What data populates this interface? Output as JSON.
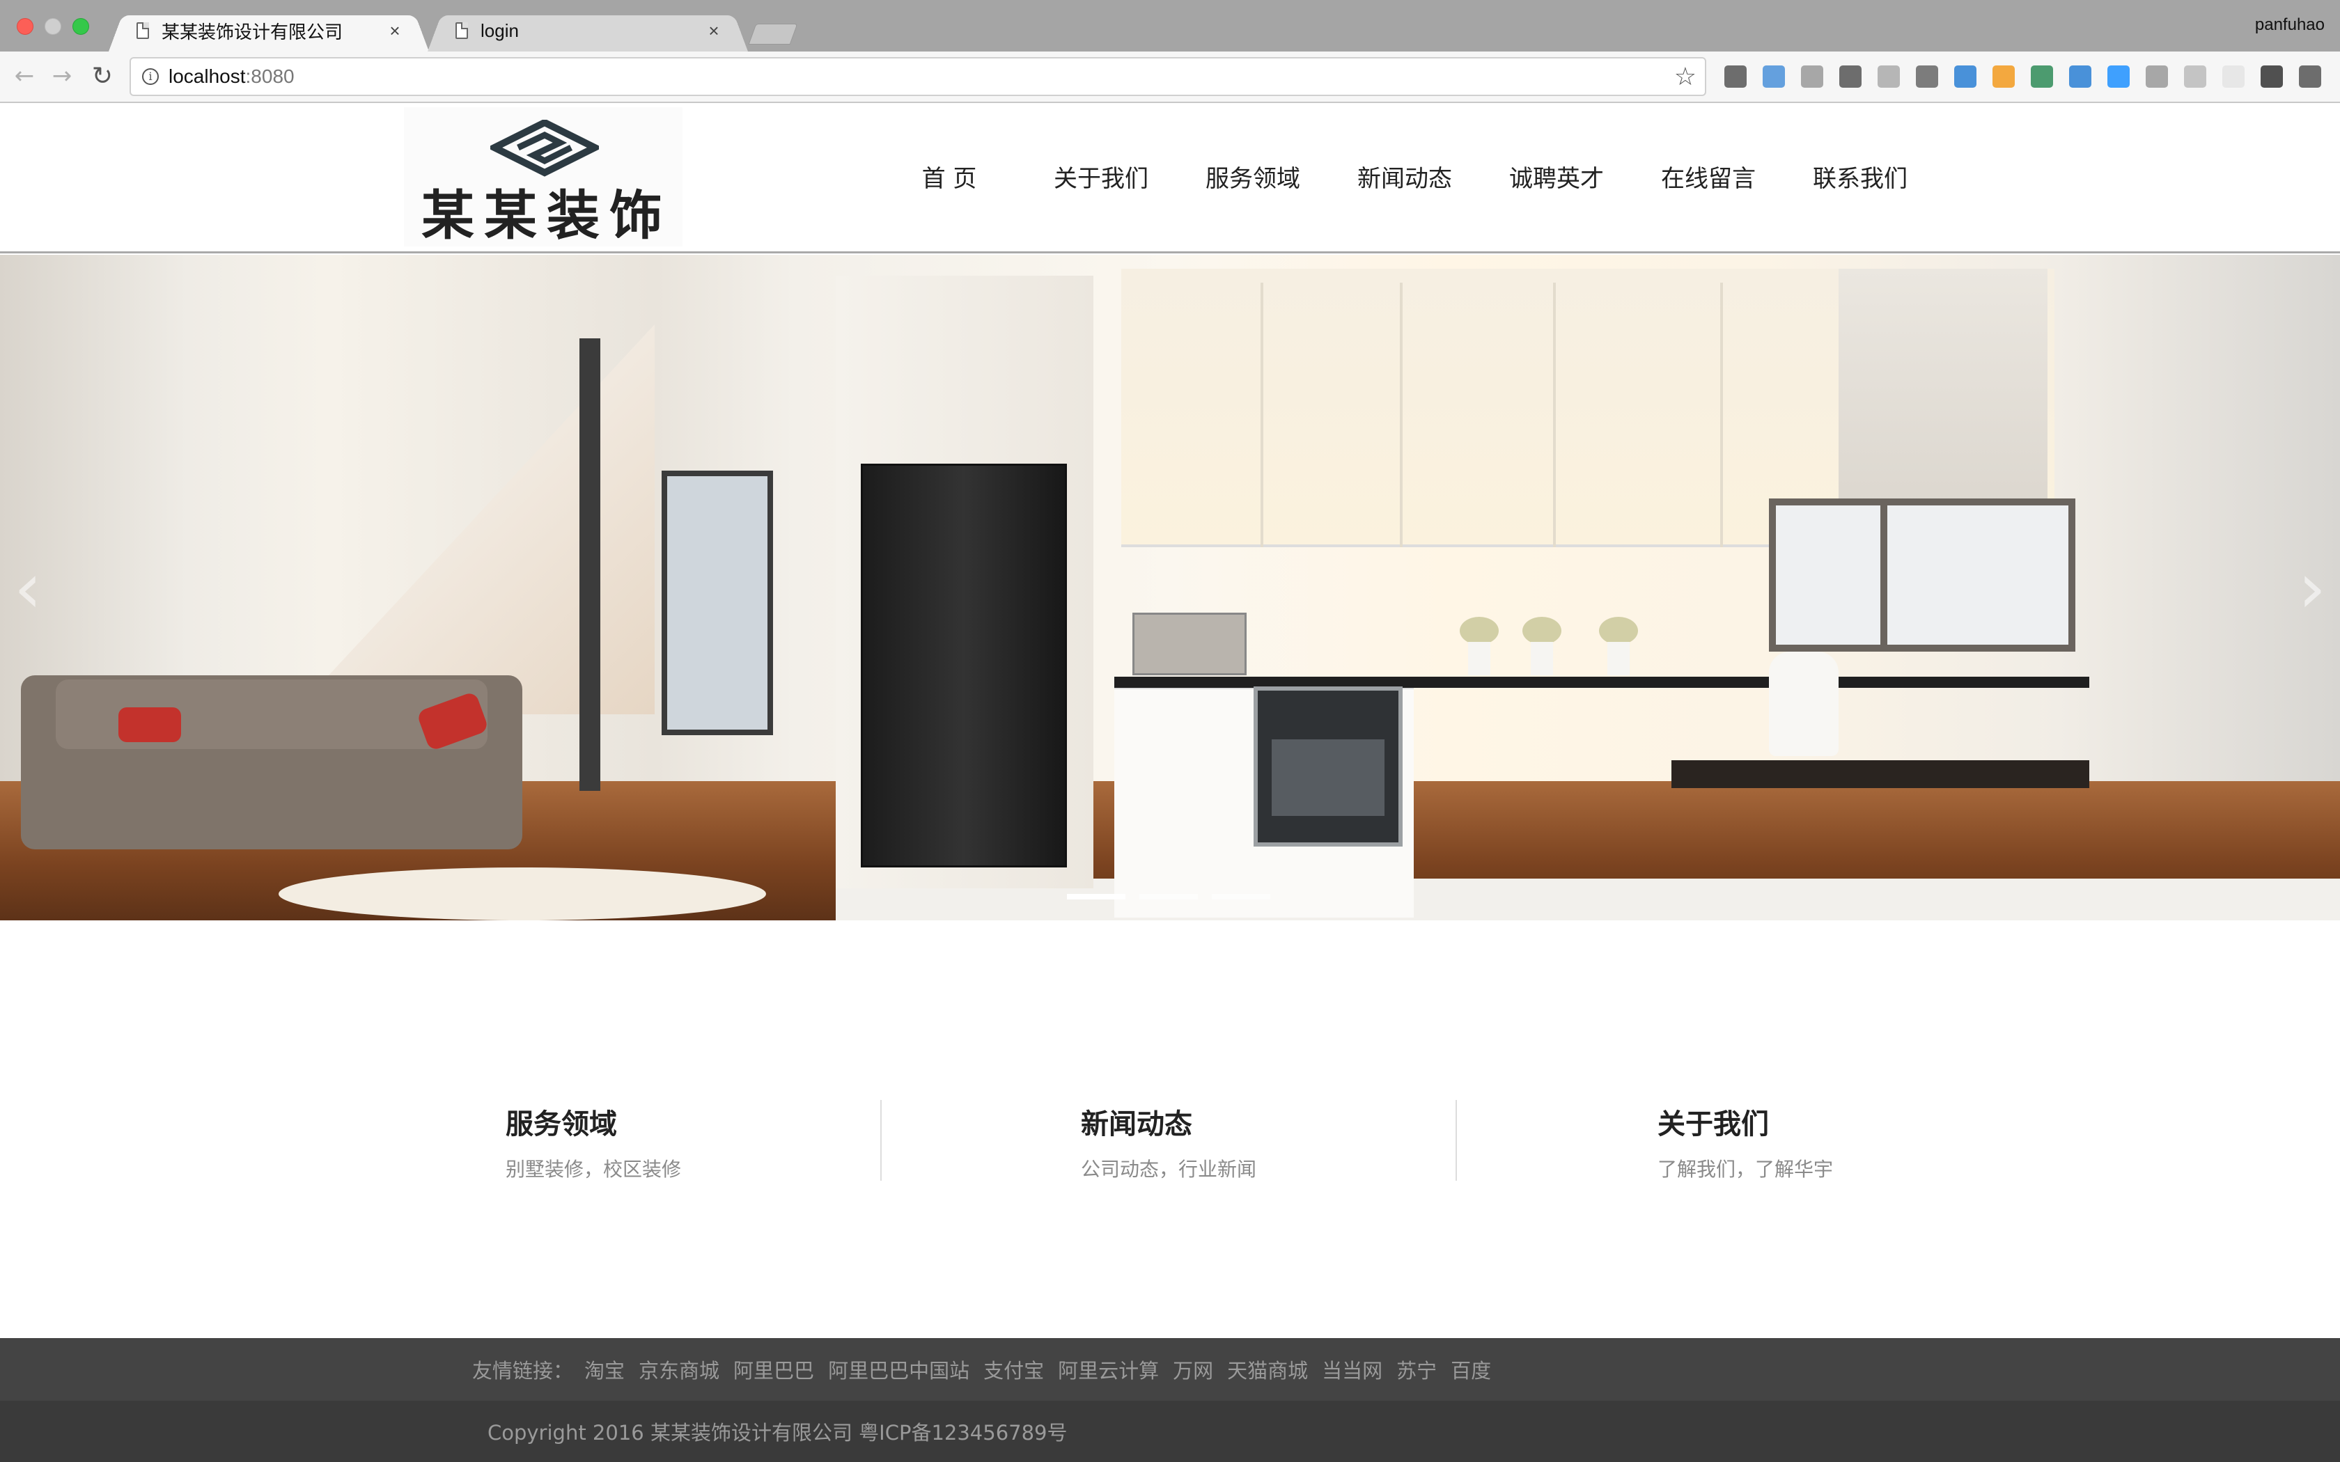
{
  "browser": {
    "tabs": [
      {
        "label": "某某装饰设计有限公司",
        "close": "×",
        "active": true
      },
      {
        "label": "login",
        "close": "×",
        "active": false
      }
    ],
    "profile": "panfuhao",
    "address": {
      "host": "localhost",
      "port": ":8080"
    },
    "extensions": [
      "qr-code-icon",
      "jh-icon",
      "cb-icon",
      "evernote-icon",
      "download-icon",
      "binary-icon",
      "jsonview-icon",
      "tag-icon",
      "chart-icon",
      "s-icon",
      "lightning-icon",
      "bird-icon",
      "page-icon",
      "circle-icon",
      "x-icon",
      "menu-icon"
    ]
  },
  "site": {
    "logo_text": "某某装饰",
    "nav": [
      "首 页",
      "关于我们",
      "服务领域",
      "新闻动态",
      "诚聘英才",
      "在线留言",
      "联系我们"
    ]
  },
  "carousel": {
    "prev_arrow": "‹",
    "next_arrow": "›",
    "slides": 3,
    "active_slide": 1
  },
  "features": [
    {
      "title": "服务领域",
      "subtitle": "别墅装修，校区装修"
    },
    {
      "title": "新闻动态",
      "subtitle": "公司动态，行业新闻"
    },
    {
      "title": "关于我们",
      "subtitle": "了解我们，了解华宇"
    }
  ],
  "footer": {
    "links_label": "友情链接：",
    "links": [
      "淘宝",
      "京东商城",
      "阿里巴巴",
      "阿里巴巴中国站",
      "支付宝",
      "阿里云计算",
      "万网",
      "天猫商城",
      "当当网",
      "苏宁",
      "百度"
    ],
    "copyright": "Copyright 2016 某某装饰设计有限公司 粤ICP备123456789号"
  },
  "colors": {
    "footer_links_bg": "#444444",
    "footer_copyright_bg": "#3a3a3a",
    "footer_text": "#9a9a9a"
  }
}
